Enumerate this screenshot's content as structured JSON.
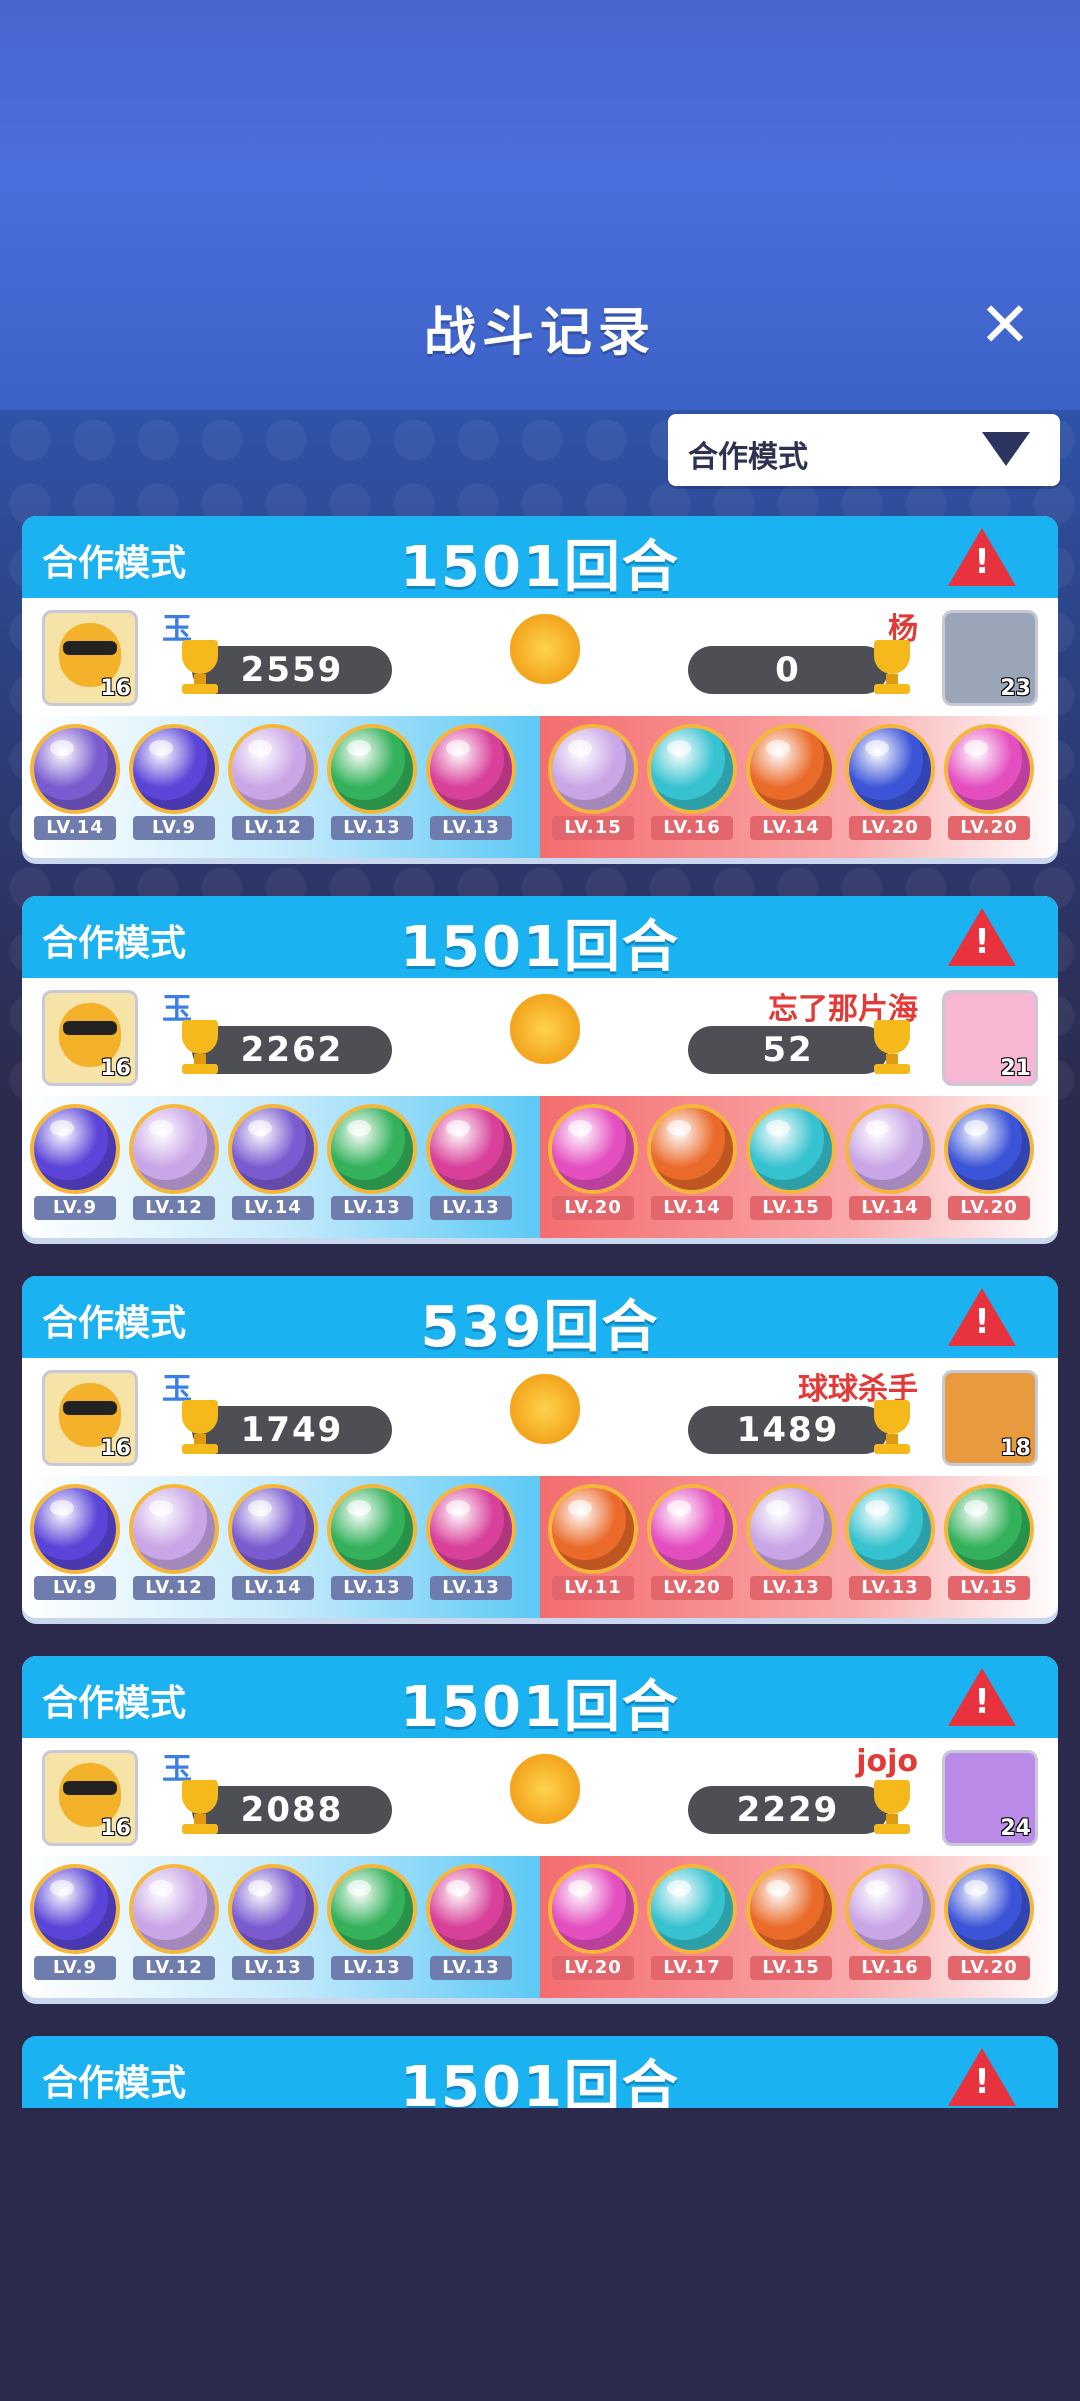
{
  "header": {
    "title": "战斗记录",
    "close_icon": "close-icon"
  },
  "filter": {
    "selected": "合作模式"
  },
  "colors": {
    "header_bar": "#1bb2f1",
    "left_name": "#3b7fe6",
    "right_name": "#e23a36"
  },
  "records": [
    {
      "mode": "合作模式",
      "rounds": "1501回合",
      "left": {
        "name": "玉",
        "level": "16",
        "trophies": "2559"
      },
      "right": {
        "name": "杨",
        "level": "23",
        "trophies": "0"
      },
      "left_orbs": [
        {
          "lv": "LV.14",
          "color": "#7a5bd0"
        },
        {
          "lv": "LV.9",
          "color": "#5b45d8"
        },
        {
          "lv": "LV.12",
          "color": "#c9a6e6"
        },
        {
          "lv": "LV.13",
          "color": "#33b15b"
        },
        {
          "lv": "LV.13",
          "color": "#d8409a"
        }
      ],
      "right_orbs": [
        {
          "lv": "LV.15",
          "color": "#c9a6e6"
        },
        {
          "lv": "LV.16",
          "color": "#36c2cf"
        },
        {
          "lv": "LV.14",
          "color": "#ea6a2a"
        },
        {
          "lv": "LV.20",
          "color": "#3c55d8"
        },
        {
          "lv": "LV.20",
          "color": "#e44fc0"
        }
      ]
    },
    {
      "mode": "合作模式",
      "rounds": "1501回合",
      "left": {
        "name": "玉",
        "level": "16",
        "trophies": "2262"
      },
      "right": {
        "name": "忘了那片海",
        "level": "21",
        "trophies": "52"
      },
      "left_orbs": [
        {
          "lv": "LV.9",
          "color": "#5b45d8"
        },
        {
          "lv": "LV.12",
          "color": "#c9a6e6"
        },
        {
          "lv": "LV.14",
          "color": "#7a5bd0"
        },
        {
          "lv": "LV.13",
          "color": "#33b15b"
        },
        {
          "lv": "LV.13",
          "color": "#d8409a"
        }
      ],
      "right_orbs": [
        {
          "lv": "LV.20",
          "color": "#e44fc0"
        },
        {
          "lv": "LV.14",
          "color": "#ea6a2a"
        },
        {
          "lv": "LV.15",
          "color": "#36c2cf"
        },
        {
          "lv": "LV.14",
          "color": "#c9a6e6"
        },
        {
          "lv": "LV.20",
          "color": "#3c55d8"
        }
      ]
    },
    {
      "mode": "合作模式",
      "rounds": "539回合",
      "left": {
        "name": "玉",
        "level": "16",
        "trophies": "1749"
      },
      "right": {
        "name": "球球杀手",
        "level": "18",
        "trophies": "1489"
      },
      "left_orbs": [
        {
          "lv": "LV.9",
          "color": "#5b45d8"
        },
        {
          "lv": "LV.12",
          "color": "#c9a6e6"
        },
        {
          "lv": "LV.14",
          "color": "#7a5bd0"
        },
        {
          "lv": "LV.13",
          "color": "#33b15b"
        },
        {
          "lv": "LV.13",
          "color": "#d8409a"
        }
      ],
      "right_orbs": [
        {
          "lv": "LV.11",
          "color": "#ea6a2a"
        },
        {
          "lv": "LV.20",
          "color": "#e44fc0"
        },
        {
          "lv": "LV.13",
          "color": "#c9a6e6"
        },
        {
          "lv": "LV.13",
          "color": "#36c2cf"
        },
        {
          "lv": "LV.15",
          "color": "#33b15b"
        }
      ]
    },
    {
      "mode": "合作模式",
      "rounds": "1501回合",
      "left": {
        "name": "玉",
        "level": "16",
        "trophies": "2088"
      },
      "right": {
        "name": "jojo",
        "level": "24",
        "trophies": "2229"
      },
      "left_orbs": [
        {
          "lv": "LV.9",
          "color": "#5b45d8"
        },
        {
          "lv": "LV.12",
          "color": "#c9a6e6"
        },
        {
          "lv": "LV.13",
          "color": "#7a5bd0"
        },
        {
          "lv": "LV.13",
          "color": "#33b15b"
        },
        {
          "lv": "LV.13",
          "color": "#d8409a"
        }
      ],
      "right_orbs": [
        {
          "lv": "LV.20",
          "color": "#e44fc0"
        },
        {
          "lv": "LV.17",
          "color": "#36c2cf"
        },
        {
          "lv": "LV.15",
          "color": "#ea6a2a"
        },
        {
          "lv": "LV.16",
          "color": "#c9a6e6"
        },
        {
          "lv": "LV.20",
          "color": "#3c55d8"
        }
      ]
    }
  ],
  "partial_record": {
    "mode": "合作模式",
    "rounds": "1501回合"
  }
}
